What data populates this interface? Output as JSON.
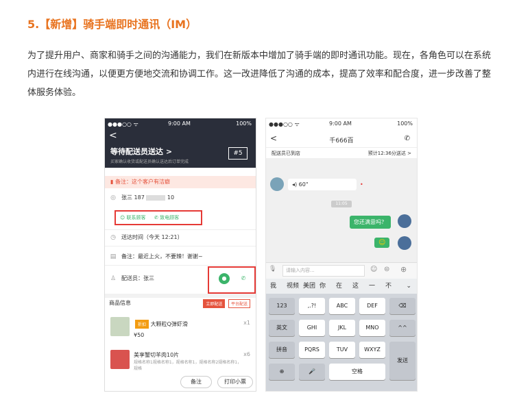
{
  "heading": "5.【新增】骑手端即时通讯（IM）",
  "paragraph": "为了提升用户、商家和骑手之间的沟通能力，我们在新版本中增加了骑手端的即时通讯功能。现在，各角色可以在系统内进行在线沟通，以便更方便地交流和协调工作。这一改进降低了沟通的成本，提高了效率和配合度，进一步改善了整体服务体验。",
  "phone1": {
    "status_left": "●●●○○ ᯤ",
    "time": "9:00 AM",
    "battery": "100%",
    "back": "<",
    "title": "等待配送员送达 >",
    "subtitle": "买家确认收货或配送员确认送达后订单完成",
    "badge": "#5",
    "note": "备注：这个客户有洁癖",
    "customer": "张三  187",
    "phone_tail": "10",
    "contact_customer": "联系顾客",
    "call_shop": "致电顾客",
    "delivery_time": "送达时间（今天 12:21）",
    "remark": "备注：最近上火，不要辣！谢谢~",
    "courier": "配送员：张三",
    "goods_title": "商品信息",
    "tag1": "立即配送",
    "tag2": "平台配送",
    "item1_name": "大颗粒Q弹虾滑",
    "item1_tag": "折扣",
    "item1_price": "¥50",
    "item1_qty": "x1",
    "item2_name": "美享蟹切羊肉10片",
    "item2_desc": "规格名称1规格名称1，规格名称1，规格名称2规格名称1，规格",
    "item2_qty": "x6",
    "btn_remark": "备注",
    "btn_print": "打印小票"
  },
  "phone2": {
    "status_left": "●●●○○ ᯤ",
    "time": "9:00 AM",
    "battery": "100%",
    "back": "<",
    "title": "千666百",
    "status": "配送员已到店",
    "eta": "预计12:36分送达 >",
    "voice": "◂) 60\"",
    "timestamp": "11:05",
    "msg1": "您还满意吗？",
    "emoji": "☺",
    "input_placeholder": "请输入内容...",
    "candidates": [
      "我",
      "视频",
      "美团",
      "你",
      "在",
      "这",
      "一",
      "不"
    ],
    "keys_row1": [
      "123",
      ",.?!",
      "ABC",
      "DEF",
      "⌫"
    ],
    "keys_row2": [
      "英文",
      "GHI",
      "JKL",
      "MNO",
      "^^"
    ],
    "keys_row3": [
      "拼音",
      "PQRS",
      "TUV",
      "WXYZ"
    ],
    "keys_row4": [
      "⊕",
      "🎤",
      "空格"
    ],
    "send": "发送"
  }
}
